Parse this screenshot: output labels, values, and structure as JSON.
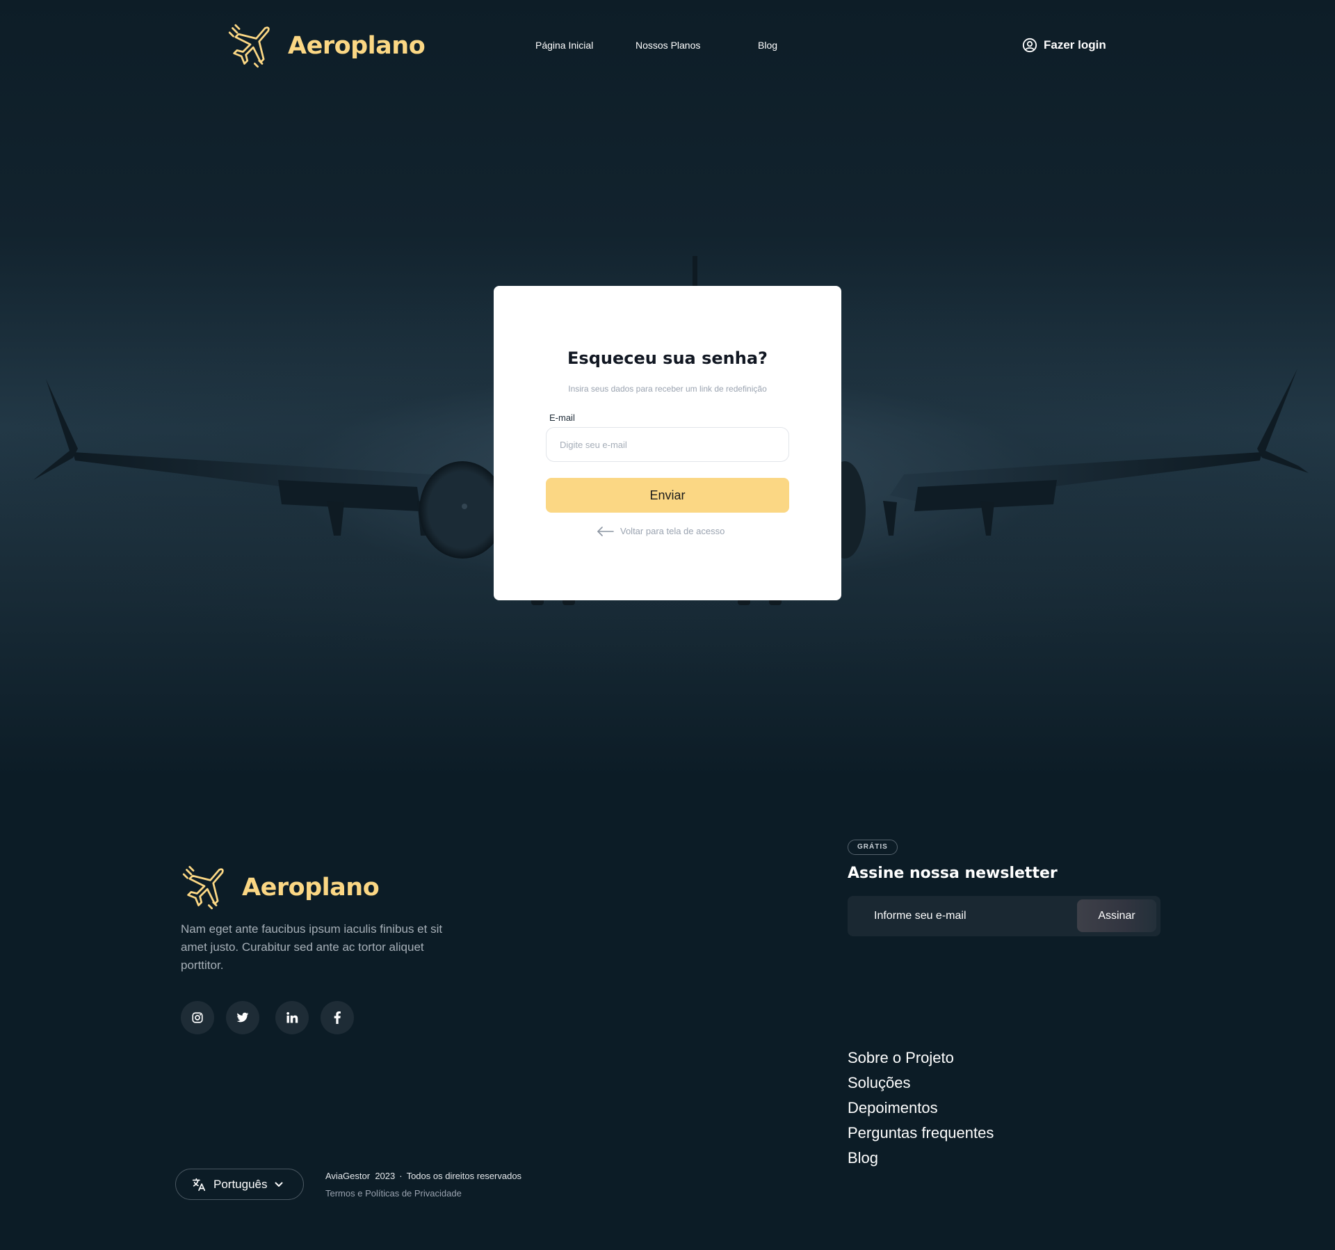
{
  "header": {
    "brand": "Aeroplano",
    "nav": [
      "Página Inicial",
      "Nossos Planos",
      "Blog"
    ],
    "login": "Fazer login"
  },
  "form": {
    "title": "Esqueceu sua senha?",
    "subtitle": "Insira seus dados para receber um link de redefinição",
    "email_label": "E-mail",
    "email_placeholder": "Digite seu e-mail",
    "submit": "Enviar",
    "back": "Voltar para tela de acesso"
  },
  "footer": {
    "brand": "Aeroplano",
    "description": "Nam eget ante faucibus ipsum iaculis finibus et sit amet justo. Curabitur sed ante ac tortor aliquet porttitor.",
    "socials": [
      "instagram-icon",
      "twitter-icon",
      "linkedin-icon",
      "facebook-icon"
    ],
    "newsletter": {
      "badge": "GRÁTIS",
      "title": "Assine nossa newsletter",
      "placeholder": "Informe seu e-mail",
      "button": "Assinar"
    },
    "links": [
      "Sobre o Projeto",
      "Soluções",
      "Depoimentos",
      "Perguntas frequentes",
      "Blog"
    ],
    "language": "Português",
    "company": "AviaGestor",
    "year": "2023",
    "rights": "Todos os direitos reservados",
    "terms": "Termos e Políticas de Privacidade"
  },
  "colors": {
    "accent": "#fbd784",
    "background": "#0c1c26",
    "card": "#ffffff"
  }
}
